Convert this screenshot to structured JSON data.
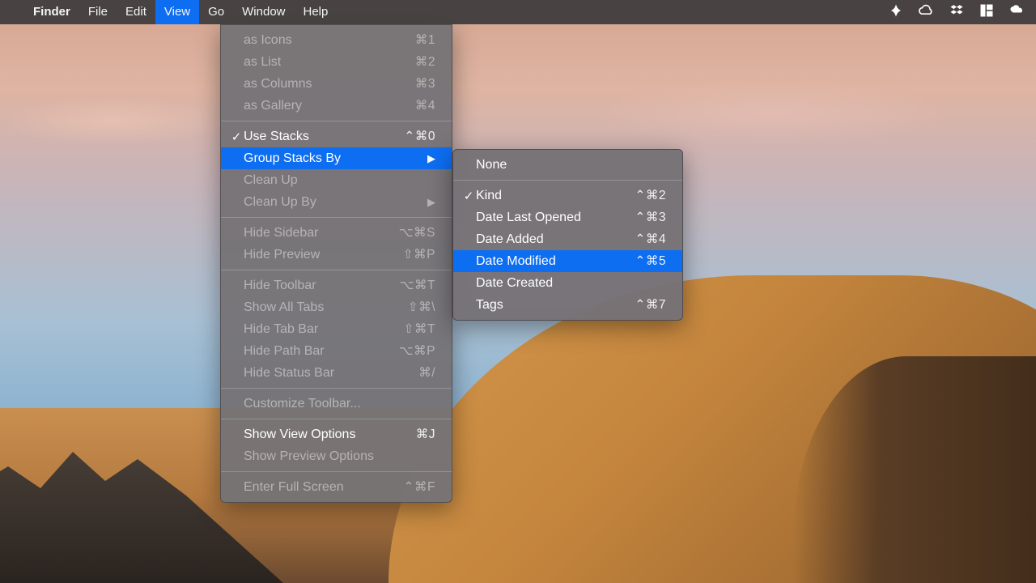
{
  "menubar": {
    "apple_icon": "apple-logo",
    "items": [
      "Finder",
      "File",
      "Edit",
      "View",
      "Go",
      "Window",
      "Help"
    ],
    "active_index": 3,
    "right_icons": [
      "bartender-icon",
      "creative-cloud-icon",
      "dropbox-icon",
      "better-snap-icon",
      "onedrive-icon"
    ]
  },
  "view_menu": {
    "groups": [
      [
        {
          "label": "as Icons",
          "shortcut": "⌘1",
          "disabled": true
        },
        {
          "label": "as List",
          "shortcut": "⌘2",
          "disabled": true
        },
        {
          "label": "as Columns",
          "shortcut": "⌘3",
          "disabled": true
        },
        {
          "label": "as Gallery",
          "shortcut": "⌘4",
          "disabled": true
        }
      ],
      [
        {
          "label": "Use Stacks",
          "shortcut": "⌃⌘0",
          "checked": true
        },
        {
          "label": "Group Stacks By",
          "submenu": true,
          "highlight": true
        },
        {
          "label": "Clean Up",
          "disabled": true
        },
        {
          "label": "Clean Up By",
          "submenu": true,
          "disabled": true
        }
      ],
      [
        {
          "label": "Hide Sidebar",
          "shortcut": "⌥⌘S",
          "disabled": true
        },
        {
          "label": "Hide Preview",
          "shortcut": "⇧⌘P",
          "disabled": true
        }
      ],
      [
        {
          "label": "Hide Toolbar",
          "shortcut": "⌥⌘T",
          "disabled": true
        },
        {
          "label": "Show All Tabs",
          "shortcut": "⇧⌘\\",
          "disabled": true
        },
        {
          "label": "Hide Tab Bar",
          "shortcut": "⇧⌘T",
          "disabled": true
        },
        {
          "label": "Hide Path Bar",
          "shortcut": "⌥⌘P",
          "disabled": true
        },
        {
          "label": "Hide Status Bar",
          "shortcut": "⌘/",
          "disabled": true
        }
      ],
      [
        {
          "label": "Customize Toolbar...",
          "disabled": true
        }
      ],
      [
        {
          "label": "Show View Options",
          "shortcut": "⌘J"
        },
        {
          "label": "Show Preview Options",
          "disabled": true
        }
      ],
      [
        {
          "label": "Enter Full Screen",
          "shortcut": "⌃⌘F",
          "disabled": true
        }
      ]
    ]
  },
  "submenu": {
    "groups": [
      [
        {
          "label": "None"
        }
      ],
      [
        {
          "label": "Kind",
          "shortcut": "⌃⌘2",
          "checked": true
        },
        {
          "label": "Date Last Opened",
          "shortcut": "⌃⌘3"
        },
        {
          "label": "Date Added",
          "shortcut": "⌃⌘4"
        },
        {
          "label": "Date Modified",
          "shortcut": "⌃⌘5",
          "highlight": true
        },
        {
          "label": "Date Created"
        },
        {
          "label": "Tags",
          "shortcut": "⌃⌘7"
        }
      ]
    ]
  }
}
